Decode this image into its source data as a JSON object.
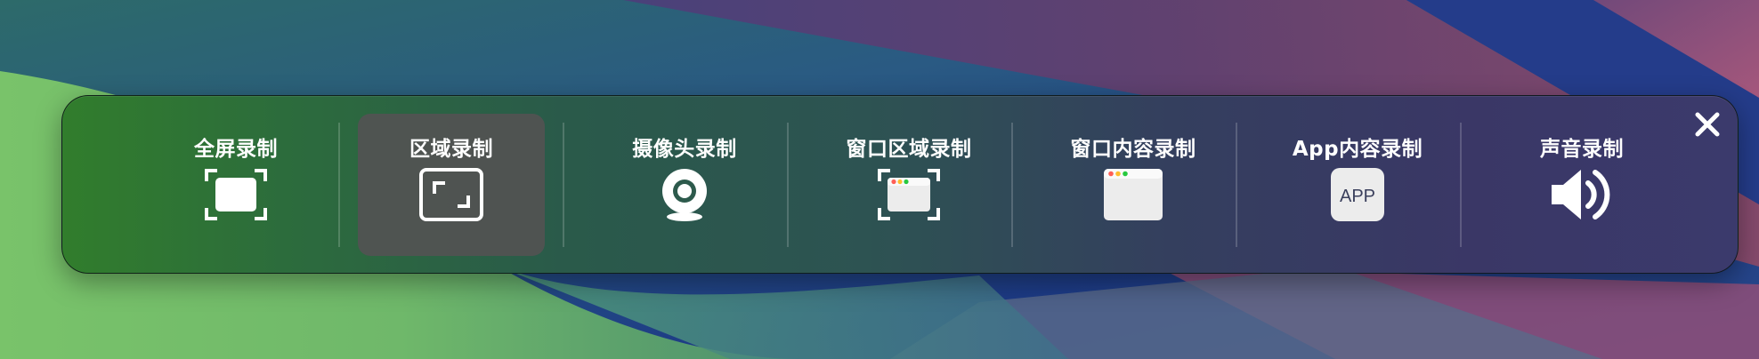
{
  "toolbar": {
    "items": [
      {
        "label": "全屏录制",
        "icon": "fullscreen-record-icon",
        "selected": false
      },
      {
        "label": "区域录制",
        "icon": "region-record-icon",
        "selected": true
      },
      {
        "label": "摄像头录制",
        "icon": "webcam-icon",
        "selected": false
      },
      {
        "label": "窗口区域录制",
        "icon": "window-region-icon",
        "selected": false
      },
      {
        "label": "窗口内容录制",
        "icon": "window-content-icon",
        "selected": false
      },
      {
        "label": "App内容录制",
        "icon": "app-content-icon",
        "app_icon_text": "APP",
        "selected": false
      },
      {
        "label": "声音录制",
        "icon": "speaker-icon",
        "selected": false
      }
    ],
    "close_icon": "close-icon"
  },
  "colors": {
    "selected_bg": "#525252",
    "text": "#ffffff",
    "window_dot_red": "#ff5f56",
    "window_dot_yellow": "#ffbd2e",
    "window_dot_green": "#27c93f"
  }
}
